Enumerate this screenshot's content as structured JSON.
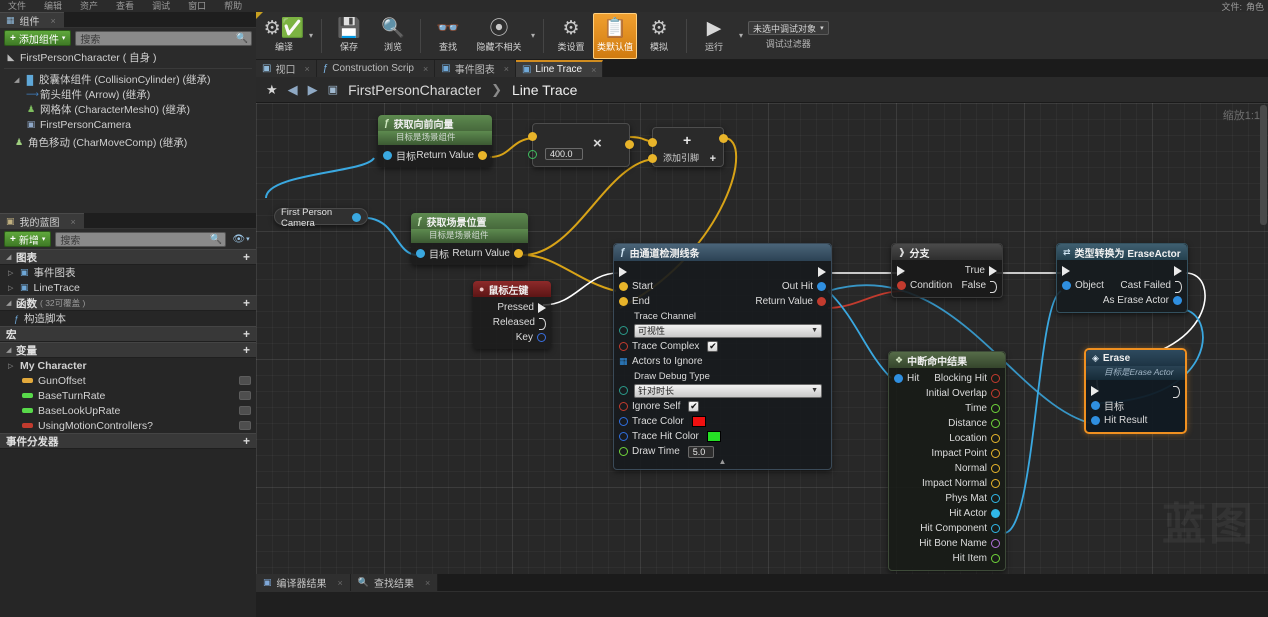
{
  "menubar": {
    "items": [
      "文件",
      "编辑",
      "资产",
      "查看",
      "调试",
      "窗口",
      "帮助"
    ],
    "right": [
      "文件:",
      "角色"
    ]
  },
  "components_panel": {
    "tab_label": "组件",
    "tab_icon": "components-icon",
    "close_icon": "×",
    "add_button": "添加组件",
    "add_plus": "+",
    "add_caret": "▾",
    "search_placeholder": "搜索",
    "search_icon": "search-icon",
    "root": "FirstPersonCharacter ( 自身 )",
    "tree": [
      {
        "label": "胶囊体组件 (CollisionCylinder) (继承)",
        "indent": 1,
        "arrow": "◢",
        "icon": "capsule-icon"
      },
      {
        "label": "箭头组件 (Arrow) (继承)",
        "indent": 2,
        "arrow": "",
        "icon": "arrow-icon"
      },
      {
        "label": "网格体 (CharacterMesh0) (继承)",
        "indent": 2,
        "arrow": "",
        "icon": "mesh-icon"
      },
      {
        "label": "FirstPersonCamera",
        "indent": 2,
        "arrow": "",
        "icon": "camera-icon"
      },
      {
        "label": "角色移动 (CharMoveComp) (继承)",
        "indent": 1,
        "arrow": "",
        "icon": "movement-icon"
      }
    ]
  },
  "myblueprint_panel": {
    "tab_label": "我的蓝图",
    "tab_icon": "blueprint-icon",
    "close_icon": "×",
    "add_button": "新增",
    "add_plus": "+",
    "add_caret": "▾",
    "search_placeholder": "搜索",
    "search_icon": "search-icon",
    "eye_icon": "eye-icon",
    "sections": [
      {
        "title": "图表",
        "collapse": "◢",
        "plus": "+",
        "items": [
          {
            "label": "事件图表",
            "arrow": "▷",
            "icon": "graph-icon"
          },
          {
            "label": "LineTrace",
            "arrow": "▷",
            "icon": "graph-icon"
          }
        ]
      },
      {
        "title": "函数",
        "sub": "( 32可覆盖 )",
        "collapse": "◢",
        "plus": "+",
        "items": [
          {
            "label": "构造脚本",
            "arrow": "",
            "icon": "function-icon"
          }
        ]
      },
      {
        "title": "宏",
        "collapse": "",
        "plus": "+",
        "items": []
      },
      {
        "title": "变量",
        "collapse": "◢",
        "plus": "+",
        "items": [
          {
            "label": "My Character",
            "arrow": "▷",
            "icon": "category-icon",
            "bold": true
          },
          {
            "label": "GunOffset",
            "arrow": "",
            "dot": "#e2a93c",
            "toggle": true
          },
          {
            "label": "BaseTurnRate",
            "arrow": "",
            "dot": "#58d94a",
            "toggle": true
          },
          {
            "label": "BaseLookUpRate",
            "arrow": "",
            "dot": "#58d94a",
            "toggle": true
          },
          {
            "label": "UsingMotionControllers?",
            "arrow": "",
            "dot": "#c23b2e",
            "toggle": true
          }
        ]
      },
      {
        "title": "事件分发器",
        "collapse": "",
        "plus": "+",
        "items": []
      }
    ]
  },
  "toolbar": {
    "buttons": [
      {
        "label": "编译",
        "icon": "compile-gears-check-icon",
        "caret": true,
        "active": false
      },
      {
        "label": "保存",
        "icon": "save-floppy-icon",
        "caret": false,
        "active": false
      },
      {
        "label": "浏览",
        "icon": "browse-magnifier-icon",
        "caret": false,
        "active": false
      },
      {
        "label": "查找",
        "icon": "find-binoculars-icon",
        "caret": false,
        "active": false
      },
      {
        "label": "隐藏不相关",
        "icon": "hide-unrelated-icon",
        "caret": true,
        "active": false
      },
      {
        "label": "类设置",
        "icon": "class-settings-icon",
        "caret": false,
        "active": false
      },
      {
        "label": "类默认值",
        "icon": "class-defaults-icon",
        "caret": false,
        "active": true
      },
      {
        "label": "模拟",
        "icon": "simulate-icon",
        "caret": false,
        "active": false
      },
      {
        "label": "运行",
        "icon": "play-icon",
        "caret": true,
        "active": false
      }
    ],
    "debug_object": "未选中调试对象",
    "debug_caret": "▾",
    "debug_filter_label": "调试过滤器"
  },
  "graph_tabs": {
    "tabs": [
      {
        "label": "视口",
        "icon": "viewport-icon",
        "selected": false
      },
      {
        "label": "Construction Scrip",
        "icon": "function-f-icon",
        "selected": false
      },
      {
        "label": "事件图表",
        "icon": "graph-icon",
        "selected": false
      },
      {
        "label": "Line Trace",
        "icon": "graph-icon",
        "selected": true
      }
    ],
    "close_icon": "×"
  },
  "breadcrumb": {
    "star_icon": "★",
    "back_icon": "◀",
    "forward_icon": "▶",
    "graph_icon": "graph-icon",
    "parent": "FirstPersonCharacter",
    "separator": "❯",
    "current": "Line Trace"
  },
  "canvas": {
    "zoom_label": "缩放1:1",
    "watermark": "蓝图"
  },
  "nodes": {
    "get_forward_vector": {
      "title": "获取向前向量",
      "subtitle": "目标是场景组件",
      "icon": "function-f-icon",
      "inputs": [
        {
          "label": "目标",
          "pin": "object"
        }
      ],
      "outputs": [
        {
          "label": "Return Value",
          "pin": "vector"
        }
      ]
    },
    "multiply": {
      "operator": "×",
      "value": "400.0"
    },
    "add": {
      "operator": "+",
      "add_pin_label": "添加引脚",
      "add_pin_icon": "+"
    },
    "first_person_camera": {
      "label": "First Person Camera"
    },
    "get_world_location": {
      "title": "获取场景位置",
      "subtitle": "目标是场景组件",
      "icon": "function-f-icon",
      "inputs": [
        {
          "label": "目标",
          "pin": "object"
        }
      ],
      "outputs": [
        {
          "label": "Return Value",
          "pin": "vector"
        }
      ]
    },
    "mouse_left": {
      "title": "鼠标左键",
      "icon": "input-mouse-icon",
      "outputs": [
        {
          "label": "Pressed",
          "pin": "exec-filled"
        },
        {
          "label": "Released",
          "pin": "exec-hollow"
        },
        {
          "label": "Key",
          "pin": "key"
        }
      ]
    },
    "line_trace_by_channel": {
      "title": "由通道检测线条",
      "icon": "function-f-icon",
      "inputs": [
        {
          "label": "Start",
          "pin": "vector"
        },
        {
          "label": "End",
          "pin": "vector"
        }
      ],
      "outputs": [
        {
          "label": "Out Hit",
          "pin": "struct-blue"
        },
        {
          "label": "Return Value",
          "pin": "bool"
        }
      ],
      "trace_channel_label": "Trace Channel",
      "trace_channel_value": "可视性",
      "trace_complex_label": "Trace Complex",
      "trace_complex_checked": "✔",
      "actors_to_ignore_label": "Actors to Ignore",
      "draw_debug_type_label": "Draw Debug Type",
      "draw_debug_type_value": "针对时长",
      "ignore_self_label": "Ignore Self",
      "ignore_self_checked": "✔",
      "trace_color_label": "Trace Color",
      "trace_color_value": "#f01010",
      "trace_hit_color_label": "Trace Hit Color",
      "trace_hit_color_value": "#25e025",
      "draw_time_label": "Draw Time",
      "draw_time_value": "5.0",
      "collapse_icon": "▲"
    },
    "branch": {
      "title": "分支",
      "icon": "branch-icon",
      "condition_label": "Condition",
      "true_label": "True",
      "false_label": "False"
    },
    "cast_to_erase_actor": {
      "title": "类型转换为 EraseActor",
      "icon": "cast-icon",
      "object_label": "Object",
      "cast_failed_label": "Cast Failed",
      "as_erase_actor_label": "As Erase Actor"
    },
    "break_hit_result": {
      "title": "中断命中结果",
      "icon": "break-struct-icon",
      "input_label": "Hit",
      "outputs": [
        {
          "label": "Blocking Hit",
          "color": "#c23b2e"
        },
        {
          "label": "Initial Overlap",
          "color": "#c23b2e"
        },
        {
          "label": "Time",
          "color": "#6fd43a"
        },
        {
          "label": "Distance",
          "color": "#6fd43a"
        },
        {
          "label": "Location",
          "color": "#e8b42a"
        },
        {
          "label": "Impact Point",
          "color": "#e8b42a"
        },
        {
          "label": "Normal",
          "color": "#e8b42a"
        },
        {
          "label": "Impact Normal",
          "color": "#e8b42a"
        },
        {
          "label": "Phys Mat",
          "color": "#30b7e8"
        },
        {
          "label": "Hit Actor",
          "color": "#30b7e8",
          "filled": true
        },
        {
          "label": "Hit Component",
          "color": "#30b7e8"
        },
        {
          "label": "Hit Bone Name",
          "color": "#b070d8"
        },
        {
          "label": "Hit Item",
          "color": "#6fd43a"
        }
      ]
    },
    "erase": {
      "title": "Erase",
      "subtitle": "目标是Erase Actor",
      "icon": "event-diamond-icon",
      "inputs": [
        {
          "label": "目标",
          "pin": "object"
        },
        {
          "label": "Hit Result",
          "pin": "struct-blue"
        }
      ]
    }
  },
  "bottom_tabs": {
    "tabs": [
      {
        "label": "编译器结果",
        "icon": "compiler-results-icon"
      },
      {
        "label": "查找结果",
        "icon": "find-results-icon"
      }
    ],
    "close_icon": "×"
  }
}
